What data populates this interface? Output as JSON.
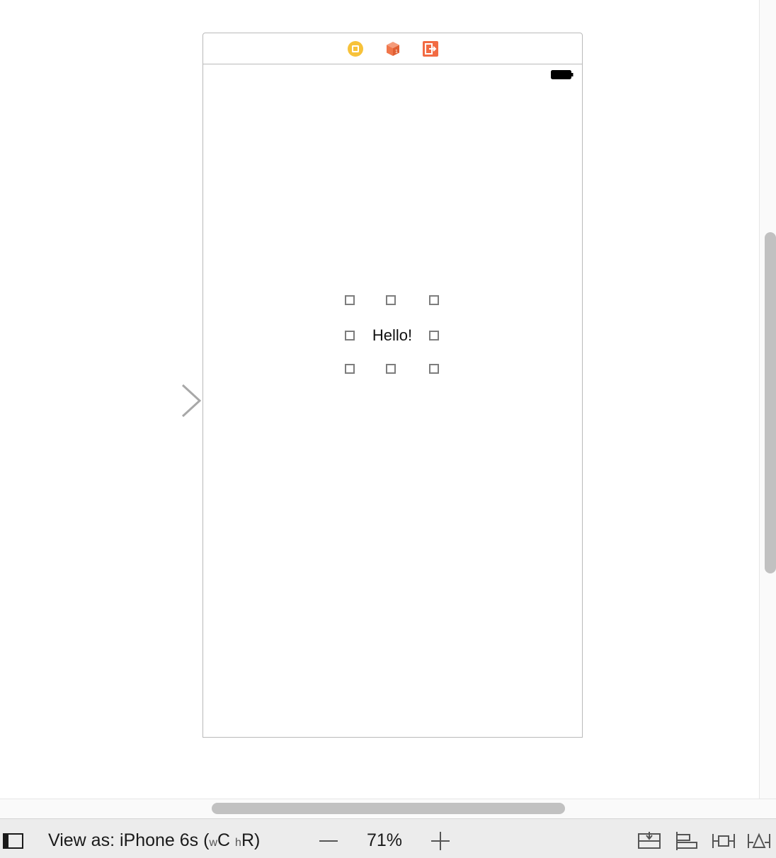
{
  "scene": {
    "label_text": "Hello!",
    "dock_icons": [
      "view-controller-icon",
      "first-responder-icon",
      "exit-icon"
    ]
  },
  "bottom_bar": {
    "view_as_prefix": "View as: iPhone 6s (",
    "width_class_small": "w",
    "width_class": "C",
    "height_class_small": "h",
    "height_class": "R)",
    "zoom_level": "71%",
    "tool_icons": [
      "embed-in-stack-icon",
      "align-icon",
      "pin-icon",
      "resolve-auto-layout-icon"
    ]
  },
  "colors": {
    "view_controller_yellow": "#f7c23a",
    "object_orange": "#f0764a",
    "exit_orange": "#f26b43",
    "selection_handle": "#7d7d7d",
    "scroll_thumb": "#c1c1c1"
  }
}
